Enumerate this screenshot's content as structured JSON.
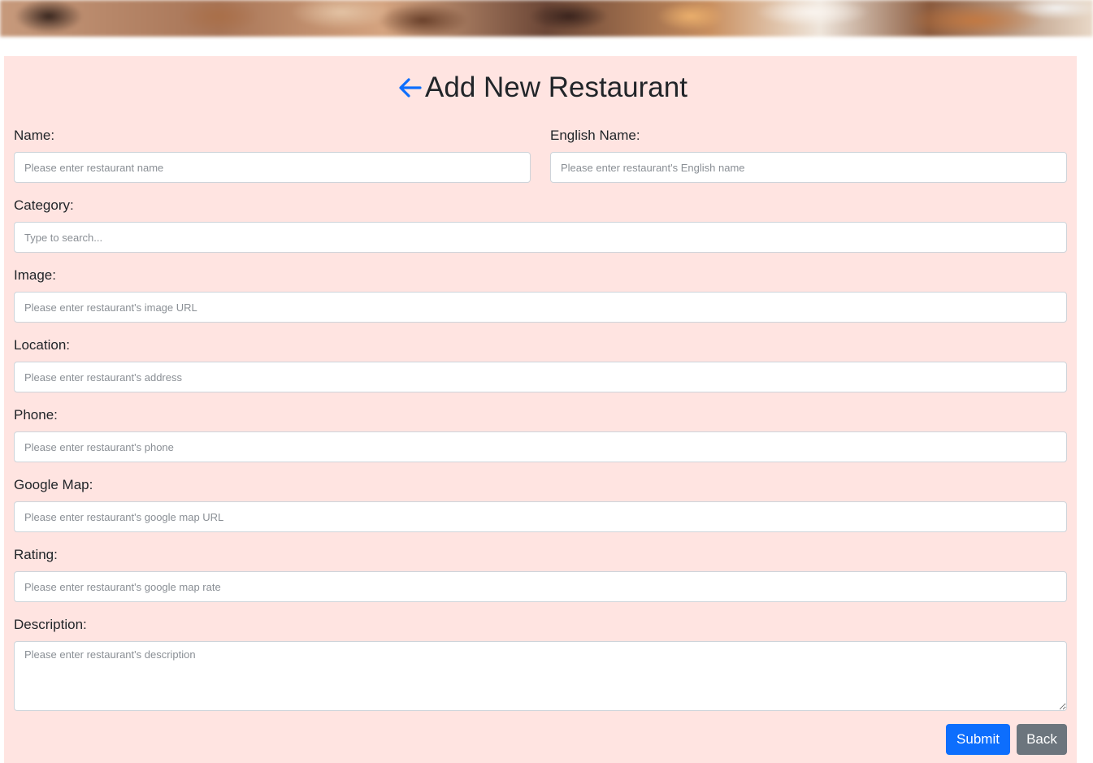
{
  "header": {
    "title": "Add New Restaurant",
    "back_icon": "arrow-left-icon",
    "accent_color": "#0d6efd"
  },
  "form": {
    "name": {
      "label": "Name:",
      "placeholder": "Please enter restaurant name"
    },
    "english_name": {
      "label": "English Name:",
      "placeholder": "Please enter restaurant's English name"
    },
    "category": {
      "label": "Category:",
      "placeholder": "Type to search..."
    },
    "image": {
      "label": "Image:",
      "placeholder": "Please enter restaurant's image URL"
    },
    "location": {
      "label": "Location:",
      "placeholder": "Please enter restaurant's address"
    },
    "phone": {
      "label": "Phone:",
      "placeholder": "Please enter restaurant's phone"
    },
    "google_map": {
      "label": "Google Map:",
      "placeholder": "Please enter restaurant's google map URL"
    },
    "rating": {
      "label": "Rating:",
      "placeholder": "Please enter restaurant's google map rate"
    },
    "description": {
      "label": "Description:",
      "placeholder": "Please enter restaurant's description"
    }
  },
  "actions": {
    "submit_label": "Submit",
    "back_label": "Back"
  },
  "colors": {
    "card_background": "#ffe4e1",
    "submit": "#0d6efd",
    "back": "#6c757d"
  }
}
